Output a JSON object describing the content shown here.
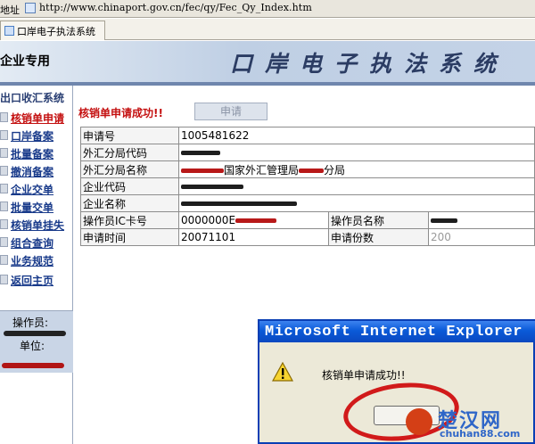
{
  "address_bar": {
    "label": "地址",
    "url": "http://www.chinaport.gov.cn/fec/qy/Fec_Qy_Index.htm"
  },
  "tab": {
    "title": "口岸电子执法系统"
  },
  "banner": {
    "left_label": "企业专用",
    "title": "口岸电子执法系统"
  },
  "sidebar": {
    "header": "出口收汇系统",
    "items": [
      {
        "label": "核销单申请",
        "active": true
      },
      {
        "label": "口岸备案"
      },
      {
        "label": "批量备案"
      },
      {
        "label": "撤消备案"
      },
      {
        "label": "企业交单"
      },
      {
        "label": "批量交单"
      },
      {
        "label": "核销单挂失"
      },
      {
        "label": "组合查询"
      },
      {
        "label": "业务规范"
      },
      {
        "label": "返回主页"
      }
    ],
    "operator_label": "操作员:",
    "unit_label": "单位:"
  },
  "main": {
    "success_message": "核销单申请成功!!",
    "apply_button": "申请",
    "rows": [
      {
        "label": "申请号",
        "value": "1005481622"
      },
      {
        "label": "外汇分局代码",
        "value": ""
      },
      {
        "label": "外汇分局名称",
        "value": "国家外汇管理局",
        "suffix": "分局"
      },
      {
        "label": "企业代码",
        "value": ""
      },
      {
        "label": "企业名称",
        "value": ""
      },
      {
        "label": "操作员IC卡号",
        "value": "0000000E",
        "label2": "操作员名称",
        "value2": ""
      },
      {
        "label": "申请时间",
        "value": "20071101",
        "label2": "申请份数",
        "value2": "200"
      }
    ]
  },
  "dialog": {
    "title": "Microsoft Internet Explorer",
    "message": "核销单申请成功!!",
    "ok_button": ""
  },
  "watermark": {
    "main": "楚汉网",
    "sub": "chuhan88.com"
  },
  "colors": {
    "accent_red": "#c41010",
    "link_blue": "#183a8a",
    "titlebar_blue": "#0a5ad8"
  }
}
